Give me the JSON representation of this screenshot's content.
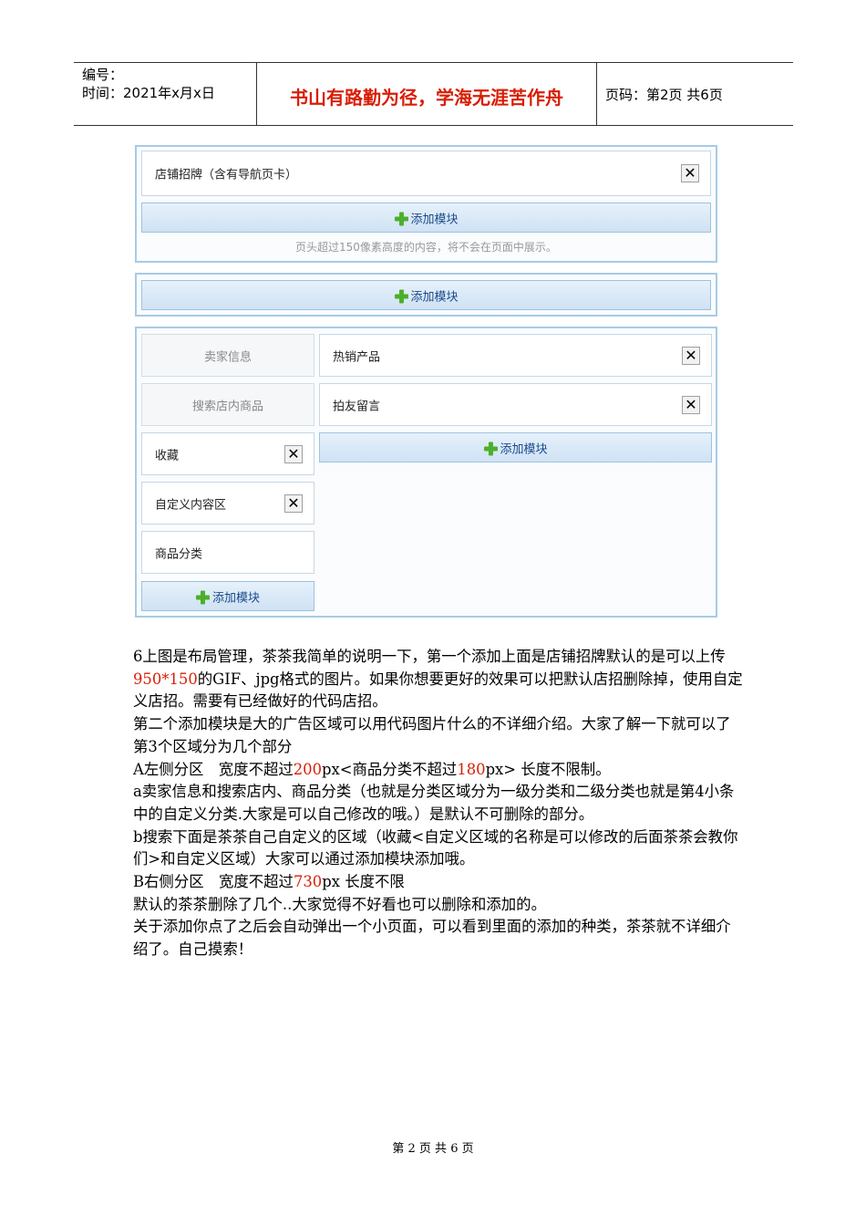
{
  "header": {
    "code_label": "编号：",
    "time_label": "时间：2021年x月x日",
    "motto": "书山有路勤为径，学海无涯苦作舟",
    "page_info": "页码：第2页 共6页"
  },
  "layout": {
    "panel1": {
      "module": "店铺招牌（含有导航页卡）",
      "add_label": "添加模块",
      "note": "页头超过150像素高度的内容，将不会在页面中展示。"
    },
    "panel2": {
      "add_label": "添加模块"
    },
    "panel3": {
      "left": [
        {
          "label": "卖家信息"
        },
        {
          "label": "搜索店内商品"
        },
        {
          "label": "收藏"
        },
        {
          "label": "自定义内容区"
        },
        {
          "label": "商品分类"
        }
      ],
      "left_add_label": "添加模块",
      "right": [
        {
          "label": "热销产品"
        },
        {
          "label": "拍友留言"
        }
      ],
      "right_add_label": "添加模块"
    },
    "close_glyph": "✕"
  },
  "body": {
    "p1": {
      "a": "6上图是布局管理，茶茶我简单的说明一下，第一个添加上面是店铺招牌默认的是可以上传",
      "red": "950*150",
      "b": "的GIF、jpg格式的图片。如果你想要更好的效果可以把默认店招删除掉，使用自定义店招。需要有已经做好的代码店招。"
    },
    "p2": "第二个添加模块是大的广告区域可以用代码图片什么的不详细介绍。大家了解一下就可以了",
    "p3": "第3个区域分为几个部分",
    "p4": {
      "a": "A左侧分区　宽度不超过",
      "red1": "200",
      "b": "px<商品分类不超过",
      "red2": "180",
      "c": "px> 长度不限制。"
    },
    "p5": "a卖家信息和搜索店内、商品分类（也就是分类区域分为一级分类和二级分类也就是第4小条中的自定义分类.大家是可以自己修改的哦。）是默认不可删除的部分。",
    "p6": "b搜索下面是茶茶自己自定义的区域（收藏<自定义区域的名称是可以修改的后面茶茶会教你们>和自定义区域）大家可以通过添加模块添加哦。",
    "p7": {
      "a": "B右侧分区　宽度不超过",
      "red": "730",
      "b": "px 长度不限"
    },
    "p8": "默认的茶茶删除了几个..大家觉得不好看也可以删除和添加的。",
    "p9": "关于添加你点了之后会自动弹出一个小页面，可以看到里面的添加的种类，茶茶就不详细介绍了。自己摸索！"
  },
  "footer": "第 2 页 共 6 页"
}
